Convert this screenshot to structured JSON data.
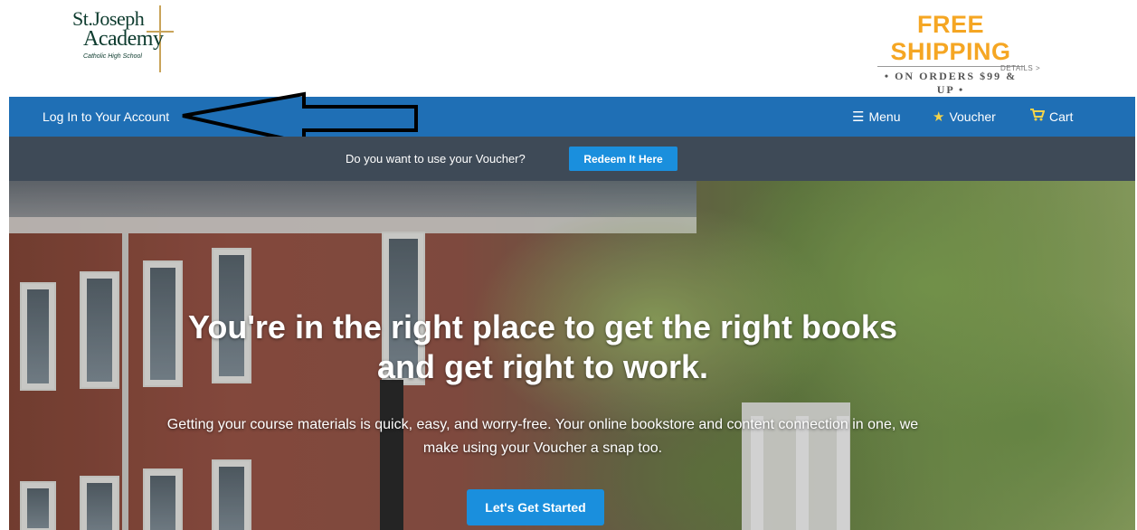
{
  "header": {
    "logo": {
      "line1": "St.Joseph",
      "line2": "Academy",
      "line3": "Catholic High School"
    },
    "promo": {
      "title": "FREE SHIPPING",
      "subtitle": "• ON ORDERS $99 & UP •",
      "details_link": "DETAILS >"
    }
  },
  "nav": {
    "login": "Log In to Your Account",
    "menu": "Menu",
    "voucher": "Voucher",
    "cart": "Cart",
    "icons": {
      "menu": "hamburger-icon",
      "voucher": "star-icon",
      "cart": "cart-icon"
    }
  },
  "voucher_bar": {
    "question": "Do you want to use your Voucher?",
    "button": "Redeem It Here"
  },
  "hero": {
    "title": "You're in the right place to get the right books and get right to work.",
    "subtitle": "Getting your course materials is quick, easy, and worry-free. Your online bookstore and content connection in one, we make using your Voucher a snap too.",
    "cta": "Let's Get Started"
  },
  "colors": {
    "nav_bg": "#1f6fb5",
    "voucher_bar_bg": "#3e4a57",
    "button_bg": "#1a8fdd",
    "promo": "#f5a623",
    "icon_accent": "#f3d34a"
  }
}
